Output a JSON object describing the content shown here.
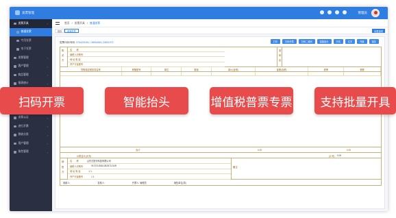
{
  "header": {
    "app_name": "发票管理",
    "user_name": "管理员"
  },
  "sidebar": {
    "items": [
      {
        "label": "发票开具",
        "type": "group"
      },
      {
        "label": "普通发票",
        "type": "active"
      },
      {
        "label": "专用发票",
        "type": "sub"
      },
      {
        "label": "电子发票",
        "type": "sub"
      },
      {
        "label": "发票管理",
        "type": "item"
      },
      {
        "label": "客户管理",
        "type": "item"
      },
      {
        "label": "商品管理",
        "type": "item"
      },
      {
        "label": "报表统计",
        "type": "item"
      },
      {
        "label": "系统设置",
        "type": "item"
      },
      {
        "label": "发票查验",
        "type": "item"
      },
      {
        "label": "发票统计",
        "type": "item"
      },
      {
        "label": "发票认证",
        "type": "item"
      },
      {
        "label": "进行开票",
        "type": "item"
      },
      {
        "label": "税收分类",
        "type": "item"
      },
      {
        "label": "用户管理",
        "type": "item"
      },
      {
        "label": "角色管理",
        "type": "item"
      }
    ]
  },
  "breadcrumb": [
    "首页",
    "发票开具",
    "普通发票"
  ],
  "tabs": [
    {
      "label": "首页"
    },
    {
      "label": "普通发票"
    }
  ],
  "tab_ops_label": "标签选项",
  "toolbar": {
    "info_prefix": "发票代码/号码:",
    "info_code": "0764231541 / 58954561",
    "info_extra": "20801973",
    "buttons": [
      "打印",
      "扫码开票",
      "扫码二维码",
      "智能抬头",
      "开具",
      "红字",
      "作废",
      "保存"
    ]
  },
  "invoice": {
    "buyer_label": "购买方",
    "buyer_rows": [
      "名　　称",
      "纳税人识别号",
      "地 址 电 话",
      "开户行及账号"
    ],
    "password_label": "密码区",
    "columns": [
      "货物或应税劳务名称",
      "规格型号",
      "单位",
      "数量",
      "单价(含税)",
      "金额(含税)",
      "税率",
      "税额"
    ],
    "total_label": "合计",
    "total_amount": "0.00",
    "total_tax": "0.00",
    "amount_words_label": "价税合计(大写)",
    "amount_small_label": "(小写)",
    "amount_small_value": "0.00",
    "seller_label": "销售方",
    "seller_rows": [
      {
        "k": "名　　称",
        "v": "山东日提可科技有限公司"
      },
      {
        "k": "纳税人识别号",
        "v": "913701008A1B2B71234R"
      },
      {
        "k": "地 址 电 话",
        "v": "1 1"
      },
      {
        "k": "开户行及账号",
        "v": "1 1"
      }
    ],
    "seller_note": "备注",
    "sign": {
      "payee": "收款人:",
      "reviewer": "复核人:",
      "drawer": "开票人:",
      "drawer_name": "管理员",
      "seller_seal": "销售单位(章)"
    }
  },
  "features": [
    "扫码开票",
    "智能抬头",
    "增值税普票专票",
    "支持批量开具"
  ],
  "colors": {
    "accent": "#2f7de1",
    "sidebar_bg": "#2a3042",
    "feature_bg": "#e84b4b",
    "invoice_line": "#c9b07a"
  }
}
